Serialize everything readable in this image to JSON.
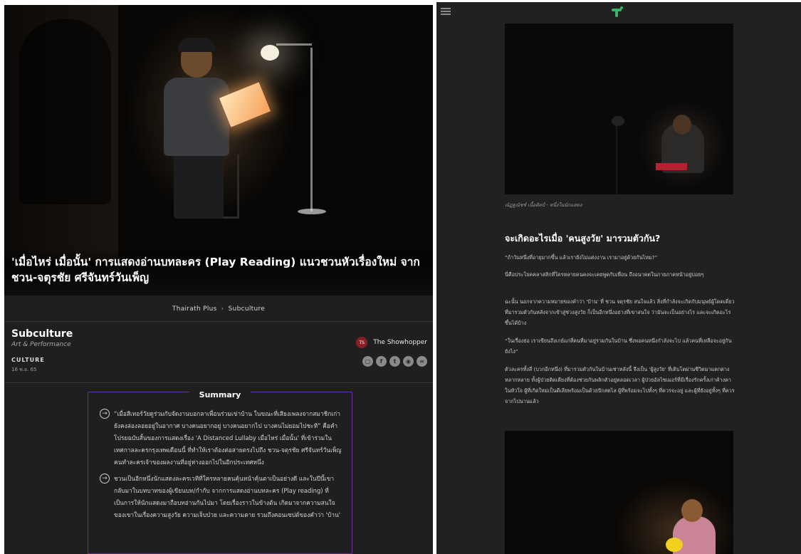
{
  "left": {
    "headline": "'เมื่อไหร่ เมื่อนั้น' การแสดงอ่านบทละคร (Play Reading) แนวชวนหัวเรื่องใหม่ จาก ชวน-จตุรชัย ศรีจันทร์วันเพ็ญ",
    "breadcrumb": {
      "home": "Thairath Plus",
      "separator": "›",
      "current": "Subculture"
    },
    "section": {
      "title": "Subculture",
      "subtitle": "Art & Performance"
    },
    "category": "CULTURE",
    "date": "16 พ.ย. 65",
    "author": {
      "name": "The Showhopper",
      "avatar_text": "TS"
    },
    "share_icons": [
      "bookmark-icon",
      "facebook-icon",
      "twitter-icon",
      "line-icon",
      "link-icon"
    ],
    "summary": {
      "heading": "Summary",
      "items": [
        "“เมื่อสีเทอร์วัยดูร่วมกับจัดงานบอกลาเพื่อนร่วมเข่าบ้าน ในขณะที่เสียงเพลงจากสมาชิกเก่ายังคงล่องลอยอยู่ในอากาศ บางคนอยากอยู่ บางคนอยากไป บางคนไม่ยอมไปชะที” คือคำโปรยฉบับสั้นของการแสดงเรื่อง 'A Distanced Lullaby เมื่อไหร่ เมื่อนั้น' ที่เข้าร่วมในเทศกาลละครกรุงเทพเดือนนี้ ที่ทำให้เราต้องต่อสายตรงไปถึง ชวน-จตุรชัย ศรีจันทร์วันเพ็ญ คนทำละครเจ้าของผลงานที่อยู่ห่างออกไปในอีกประเทศหนึ่ง",
        "ชวนเป็นอีกหนึ่งนักแสดงละครเวทีที่ใครหลายคนคุ้นหน้าคุ้นตาเป็นอย่างดี และในปีนี้เขากลับมาในบทบาทของผู้เขียนบท/กำกับ จากการแสดงอ่านบทละคร (Play reading) ที่เป็นการให้นักแสดงมาถือบทอ่านกันไปมา โดยเรื่องราวในข้างต้น เกิดมาจากความสนใจของเขาในเรื่องความสูงวัย ความเจ็บป่วย และความตาย รวมถึงคอนเซปต์ของคำว่า 'บ้าน'"
      ]
    }
  },
  "right": {
    "caption": "ณัฏฐณัชช์ เนื้อศิลป์ - หนึ่งในนักแสดง",
    "heading": "จะเกิดอะไรเมื่อ 'คนสูงวัย' มารวมตัวกัน?",
    "paragraphs": [
      "“ถ้าวันหนึ่งที่อายุมากขึ้น แล้วเรายังไม่แต่งงาน เรามาอยู่ด้วยกันไหม?”",
      "นี่คือประโยคคลาสสิกที่ใครหลายคนคงจะเคยพูดกับเพื่อน ถึงอนาคตในภายภาคหน้าอยู่บ่อยๆ",
      "ฉะนั้น นอกจากความหมายของคำว่า 'บ้าน' ที่ ชวน จตุรชัย สนใจแล้ว สิ่งที่กำลังจะเกิดกับมนุษย์ผู้โดดเดี่ยวที่มารวมตัวกันหลังจากเข้าสู่ช่วงสูงวัย ก็เป็นอีกหนึ่งอย่างที่เขาสนใจ ว่ามันจะเป็นอย่างไร และจะเกิดอะไรขึ้นได้บ้าง",
      "“ในเรื่องย่อ เราเขียนถึงเกย์แก่สี่คนที่มาอยู่รวมกันในบ้าน ซึ่งพอคนหนึ่งกำลังจะไป แล้วคนที่เหลือจะอยู่กันยังไง”",
      "ตัวละครทั้งสี่ (บวกอีกหนึ่ง) ที่มารวมตัวกันในบ้านเช่าหลังนี้ จึงเป็น 'ผู้สูงวัย' ที่เติบโตผ่านชีวิตมาแตกต่างหลากหลาย ทั้งผู้ป่วยติดเตียงที่ต้องช่วยกันพลิกตัวอยู่ตลอดเวลา ผู้ป่วยอัลไซเมอร์ที่มีเรื่องรักครั้งเก่าค้างคาในหัวใจ ผู้ที่เกิดใหม่เป็นดีเลียพร้อมเป็นด้วยปักสตไล ผู้ที่พร้อมจะไปทั้งๆ ที่ควรจะอยู่ และผู้ที่ยังอยู่ทั้งๆ ที่ควรจากไปนานแล้ว"
    ]
  },
  "colors": {
    "background": "#1f1f1f",
    "summary_border": "#6b2fa2",
    "logo": "#35b56a",
    "author_avatar": "#8b1e23"
  }
}
